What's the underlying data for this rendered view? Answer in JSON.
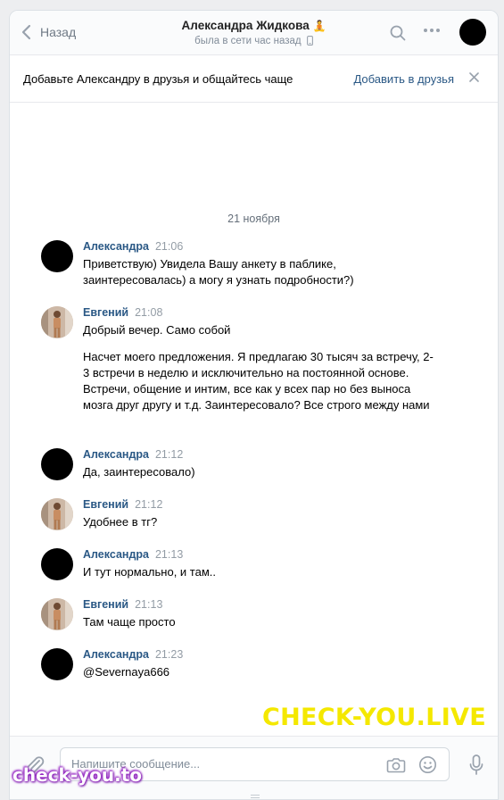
{
  "header": {
    "back_label": "Назад",
    "title": "Александра Жидкова",
    "title_emoji": "🧘",
    "status": "была в сети час назад"
  },
  "banner": {
    "text": "Добавьте Александру в друзья и общайтесь чаще",
    "add_friend": "Добавить в друзья"
  },
  "date_divider": "21 ноября",
  "messages": [
    {
      "author": "Александра",
      "time": "21:06",
      "avatar": "black",
      "paragraphs": [
        "Приветствую) Увидела Вашу анкету в паблике, заинтересовалась) а могу я узнать подробности?)"
      ]
    },
    {
      "author": "Евгений",
      "time": "21:08",
      "avatar": "photo",
      "paragraphs": [
        "Добрый вечер. Само собой",
        "Насчет моего предложения. Я предлагаю 30 тысяч за встречу, 2-3 встречи в неделю и исключительно на постоянной основе. Встречи, общение и интим, все как у всех пар но без выноса мозга друг другу и т.д. Заинтересовало? Все строго между нами"
      ]
    },
    {
      "author": "Александра",
      "time": "21:12",
      "avatar": "black",
      "paragraphs": [
        "Да, заинтересовало)"
      ]
    },
    {
      "author": "Евгений",
      "time": "21:12",
      "avatar": "photo",
      "paragraphs": [
        "Удобнее в тг?"
      ]
    },
    {
      "author": "Александра",
      "time": "21:13",
      "avatar": "black",
      "paragraphs": [
        "И тут нормально, и там.."
      ]
    },
    {
      "author": "Евгений",
      "time": "21:13",
      "avatar": "photo",
      "paragraphs": [
        "Там чаще просто"
      ]
    },
    {
      "author": "Александра",
      "time": "21:23",
      "avatar": "black",
      "paragraphs": [
        "@Severnaya666"
      ]
    }
  ],
  "composer": {
    "placeholder": "Напишите сообщение..."
  },
  "watermarks": {
    "top": "CHECK-YOU.LIVE",
    "bottom": "check-you.to"
  },
  "colors": {
    "link": "#2a5885",
    "muted": "#818c99",
    "watermark_yellow": "#f4e800",
    "watermark_purple": "#9a2bc7"
  },
  "icons": [
    "chevron-left-icon",
    "phone-icon",
    "search-icon",
    "more-icon",
    "close-icon",
    "paperclip-icon",
    "camera-icon",
    "smile-icon",
    "microphone-icon"
  ]
}
